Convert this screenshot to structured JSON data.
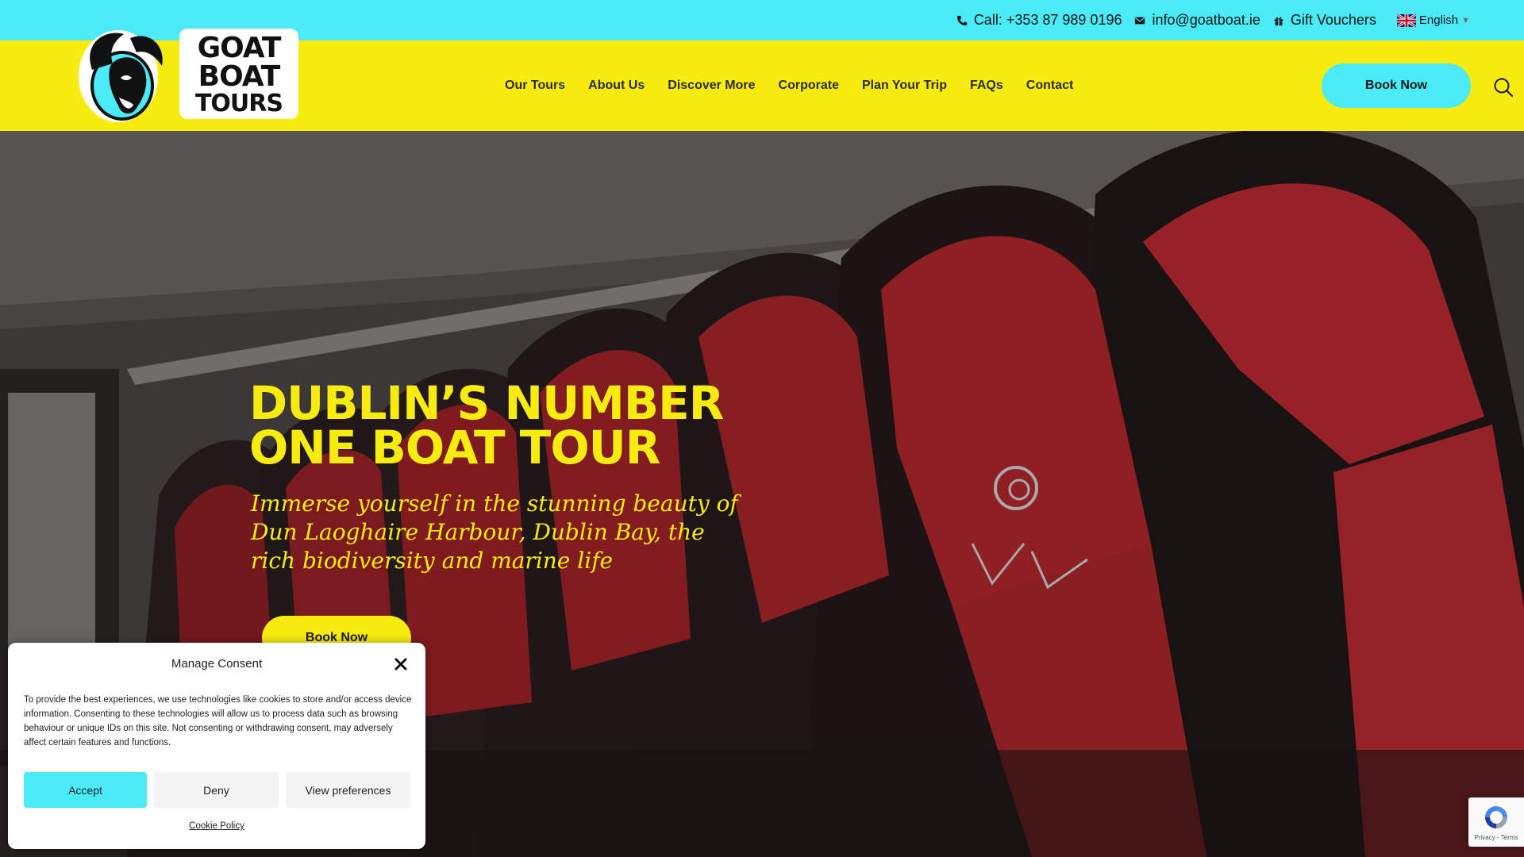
{
  "topbar": {
    "phone": "Call: +353 87 989 0196",
    "email": "info@goatboat.ie",
    "vouchers": "Gift Vouchers",
    "language": "English"
  },
  "logo": {
    "line1": "GOAT",
    "line2": "BOAT",
    "line3": "TOURS"
  },
  "nav": {
    "items": [
      "Our Tours",
      "About Us",
      "Discover More",
      "Corporate",
      "Plan Your Trip",
      "FAQs",
      "Contact"
    ],
    "book_label": "Book Now"
  },
  "hero": {
    "title_line1": "DUBLIN’S NUMBER",
    "title_line2": "ONE BOAT TOUR",
    "subtitle": "Immerse yourself in the stunning beauty of Dun Laoghaire Harbour, Dublin Bay, the rich biodiversity and marine life",
    "book_label": "Book Now"
  },
  "consent": {
    "title": "Manage Consent",
    "text": "To provide the best experiences, we use technologies like cookies to store and/or access device information. Consenting to these technologies will allow us to process data such as browsing behaviour or unique IDs on this site. Not consenting or withdrawing consent, may adversely affect certain features and functions.",
    "accept": "Accept",
    "deny": "Deny",
    "preferences": "View preferences",
    "policy_link": "Cookie Policy"
  },
  "recaptcha": {
    "links": "Privacy - Terms"
  },
  "colors": {
    "cyan": "#4beaf7",
    "yellow": "#f8ec0f",
    "dark": "#1b1b1b"
  },
  "icons": [
    "phone-icon",
    "envelope-icon",
    "gift-icon",
    "uk-flag-icon",
    "search-icon",
    "close-icon",
    "recaptcha-icon"
  ]
}
